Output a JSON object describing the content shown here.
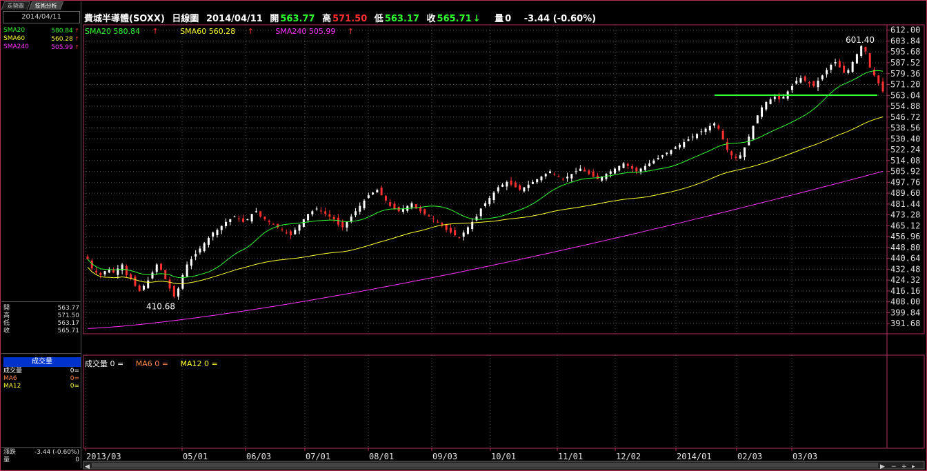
{
  "tabs": [
    "走勢圖",
    "技術分析"
  ],
  "left_panel": {
    "date": "2014/04/11",
    "sma": [
      {
        "label": "SMA20",
        "value": "580.84",
        "color": "#33ff33"
      },
      {
        "label": "SMA60",
        "value": "560.28",
        "color": "#ffff33"
      },
      {
        "label": "SMA240",
        "value": "505.99",
        "color": "#ff33ff"
      }
    ],
    "quote": [
      {
        "label": "開",
        "value": "563.77"
      },
      {
        "label": "高",
        "value": "571.50"
      },
      {
        "label": "低",
        "value": "563.17"
      },
      {
        "label": "收",
        "value": "565.71"
      }
    ],
    "volume_title": "成交量",
    "volume": [
      {
        "label": "成交量",
        "value": "0=",
        "color": "#ffffff"
      },
      {
        "label": "MA6",
        "value": "0=",
        "color": "#ff8844"
      },
      {
        "label": "MA12",
        "value": "0=",
        "color": "#ffff33"
      }
    ],
    "change_label": "漲跌",
    "change_value": "-3.44 (-0.60%)",
    "vol_label": "量",
    "vol_value": "0"
  },
  "header": {
    "title": "費城半導體(SOXX)",
    "period": "日線圖",
    "date": "2014/04/11",
    "open_label": "開",
    "open": "563.77",
    "high_label": "高",
    "high": "571.50",
    "low_label": "低",
    "low": "563.17",
    "close_label": "收",
    "close": "565.71",
    "volume_label": "量",
    "volume": "0",
    "change": "-3.44 (-0.60%)"
  },
  "legend": [
    {
      "text": "SMA20 580.84",
      "color": "#33ff33"
    },
    {
      "text": "SMA60 560.28",
      "color": "#ffff33"
    },
    {
      "text": "SMA240 505.99",
      "color": "#ff33ff"
    }
  ],
  "volume_legend": [
    {
      "text": "成交量 0 =",
      "color": "#ffffff"
    },
    {
      "text": "MA6 0 =",
      "color": "#ff8844"
    },
    {
      "text": "MA12 0 =",
      "color": "#ffff33"
    }
  ],
  "chart_data": {
    "type": "candlestick",
    "y_ticks": [
      "612.00",
      "603.84",
      "595.68",
      "587.52",
      "579.36",
      "571.20",
      "563.04",
      "554.88",
      "546.72",
      "538.56",
      "530.40",
      "522.24",
      "514.08",
      "505.92",
      "497.76",
      "489.60",
      "481.44",
      "473.28",
      "465.12",
      "456.96",
      "448.80",
      "440.64",
      "432.48",
      "424.32",
      "416.16",
      "408.00",
      "399.84",
      "391.68"
    ],
    "ylim": [
      384,
      616
    ],
    "x_labels": [
      "2013/03",
      "05/01",
      "06/03",
      "07/01",
      "08/01",
      "09/03",
      "10/01",
      "11/01",
      "12/02",
      "2014/01",
      "02/03",
      "03/03"
    ],
    "annotations": [
      {
        "text": "601.40",
        "value": 601.4
      },
      {
        "text": "410.68",
        "value": 410.68
      }
    ],
    "support_line": 563.2,
    "closes": [
      440,
      433,
      430,
      428,
      431,
      432,
      430,
      433,
      436,
      428,
      425,
      420,
      416,
      420,
      424,
      430,
      436,
      432,
      425,
      418,
      412,
      418,
      428,
      436,
      440,
      444,
      448,
      452,
      456,
      460,
      462,
      465,
      468,
      470,
      472,
      470,
      468,
      470,
      474,
      476,
      472,
      470,
      468,
      466,
      464,
      462,
      460,
      458,
      462,
      466,
      470,
      474,
      476,
      478,
      476,
      474,
      472,
      470,
      466,
      464,
      468,
      472,
      476,
      480,
      484,
      488,
      490,
      492,
      488,
      484,
      480,
      478,
      476,
      478,
      480,
      482,
      478,
      476,
      474,
      472,
      470,
      468,
      466,
      462,
      460,
      458,
      456,
      460,
      464,
      468,
      472,
      478,
      482,
      486,
      490,
      494,
      496,
      498,
      496,
      494,
      492,
      494,
      496,
      498,
      500,
      502,
      504,
      506,
      504,
      502,
      500,
      502,
      504,
      506,
      508,
      506,
      504,
      502,
      500,
      502,
      504,
      506,
      508,
      510,
      512,
      510,
      508,
      506,
      508,
      510,
      512,
      514,
      516,
      518,
      520,
      522,
      524,
      526,
      528,
      530,
      532,
      534,
      536,
      538,
      540,
      542,
      538,
      530,
      522,
      518,
      516,
      518,
      524,
      532,
      540,
      548,
      554,
      558,
      560,
      562,
      560,
      562,
      566,
      570,
      574,
      576,
      574,
      572,
      570,
      574,
      578,
      582,
      586,
      588,
      584,
      580,
      582,
      588,
      594,
      600,
      596,
      584,
      578,
      572,
      566
    ]
  }
}
